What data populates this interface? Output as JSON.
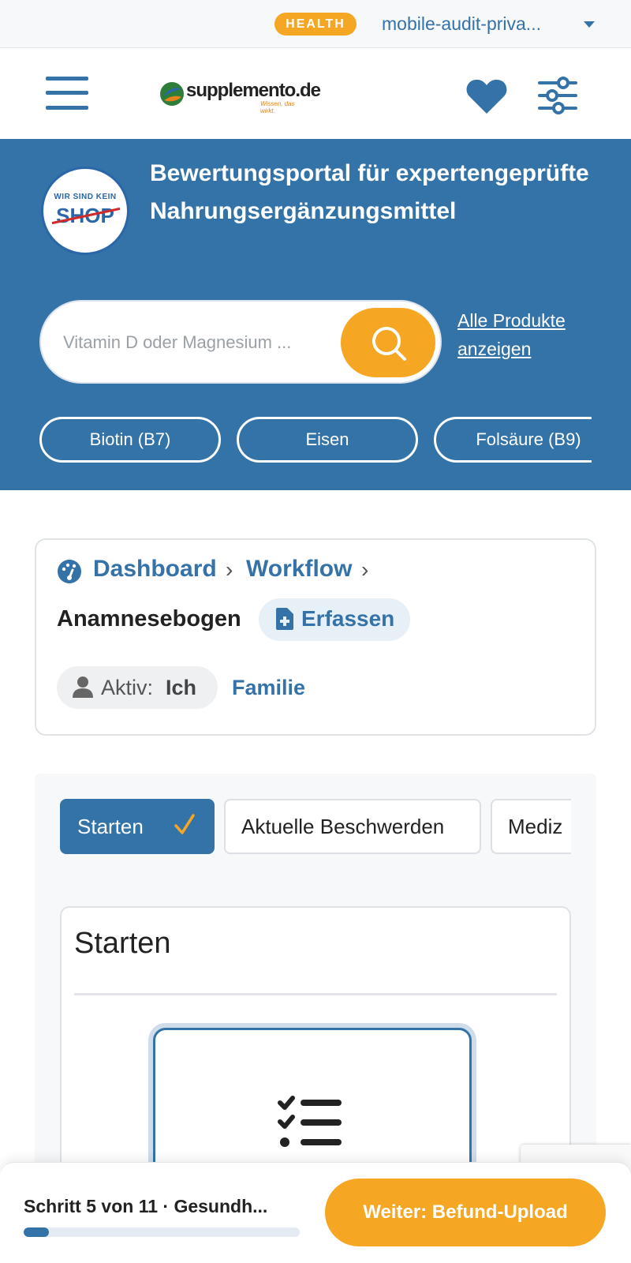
{
  "topbar": {
    "badge": "HEALTH",
    "account": "mobile-audit-priva...",
    "accent": "#f5a623"
  },
  "header": {
    "logo_text": "supplemento.de",
    "logo_sub": "Wissen, das wirkt.",
    "icons": [
      "menu-icon",
      "heart-icon",
      "filter-icon"
    ]
  },
  "hero": {
    "badge_small": "WIR SIND KEIN",
    "badge_big": "SHOP",
    "title": "Bewertungsportal für expertengeprüfte Nahrungsergänzungsmittel",
    "search_placeholder": "Vitamin D oder Magnesium ...",
    "all_products": "Alle Produkte anzeigen",
    "chips": [
      "Biotin (B7)",
      "Eisen",
      "Folsäure (B9)"
    ],
    "background": "#3473a8"
  },
  "breadcrumb": {
    "items": [
      "Dashboard",
      "Workflow"
    ],
    "current": "Anamnesebogen",
    "action": "Erfassen",
    "active_label": "Aktiv:",
    "active_value": "Ich",
    "family": "Familie"
  },
  "workflow": {
    "steps": [
      "Starten",
      "Aktuelle Beschwerden",
      "Mediz"
    ],
    "active_step": "Starten",
    "card_title": "Starten"
  },
  "footer": {
    "step_label": "Schritt 5 von 11 · Gesundh...",
    "progress": 0.09,
    "next_button": "Weiter: Befund-Upload"
  }
}
